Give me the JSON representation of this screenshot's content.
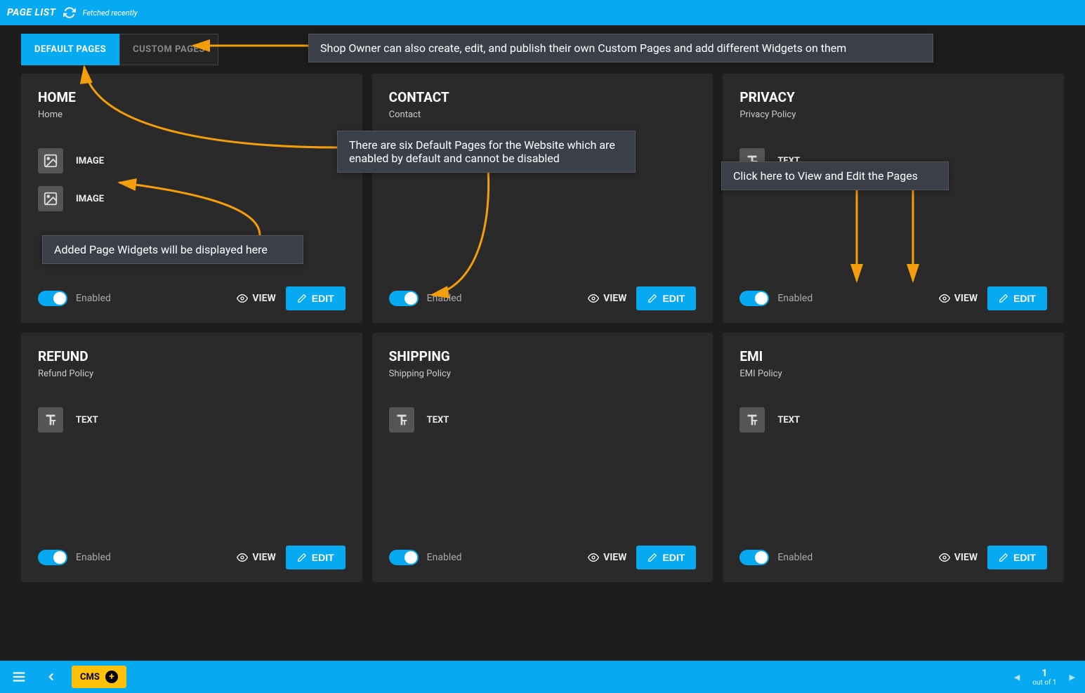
{
  "header": {
    "title": "PAGE LIST",
    "fetched": "Fetched recently"
  },
  "tabs": {
    "default": "DEFAULT PAGES",
    "custom": "CUSTOM PAGES"
  },
  "common": {
    "enabled": "Enabled",
    "view": "VIEW",
    "edit": "EDIT"
  },
  "pages": [
    {
      "title": "HOME",
      "subtitle": "Home",
      "widgets": [
        {
          "type": "image",
          "label": "IMAGE"
        },
        {
          "type": "image",
          "label": "IMAGE"
        }
      ]
    },
    {
      "title": "CONTACT",
      "subtitle": "Contact",
      "widgets": []
    },
    {
      "title": "PRIVACY",
      "subtitle": "Privacy Policy",
      "widgets": [
        {
          "type": "text",
          "label": "TEXT"
        }
      ]
    },
    {
      "title": "REFUND",
      "subtitle": "Refund Policy",
      "widgets": [
        {
          "type": "text",
          "label": "TEXT"
        }
      ]
    },
    {
      "title": "SHIPPING",
      "subtitle": "Shipping Policy",
      "widgets": [
        {
          "type": "text",
          "label": "TEXT"
        }
      ]
    },
    {
      "title": "EMI",
      "subtitle": "EMI Policy",
      "widgets": [
        {
          "type": "text",
          "label": "TEXT"
        }
      ]
    }
  ],
  "annotations": {
    "custom_tab": "Shop Owner can also create, edit, and publish their own Custom Pages and add different Widgets on them",
    "default_six": "There are six Default Pages for the Website which are enabled by default and cannot be disabled",
    "widgets_here": "Added Page Widgets will be displayed here",
    "view_edit": "Click here to View and Edit the Pages"
  },
  "footer": {
    "cms": "CMS",
    "page": "1",
    "out_of": "out of 1"
  }
}
